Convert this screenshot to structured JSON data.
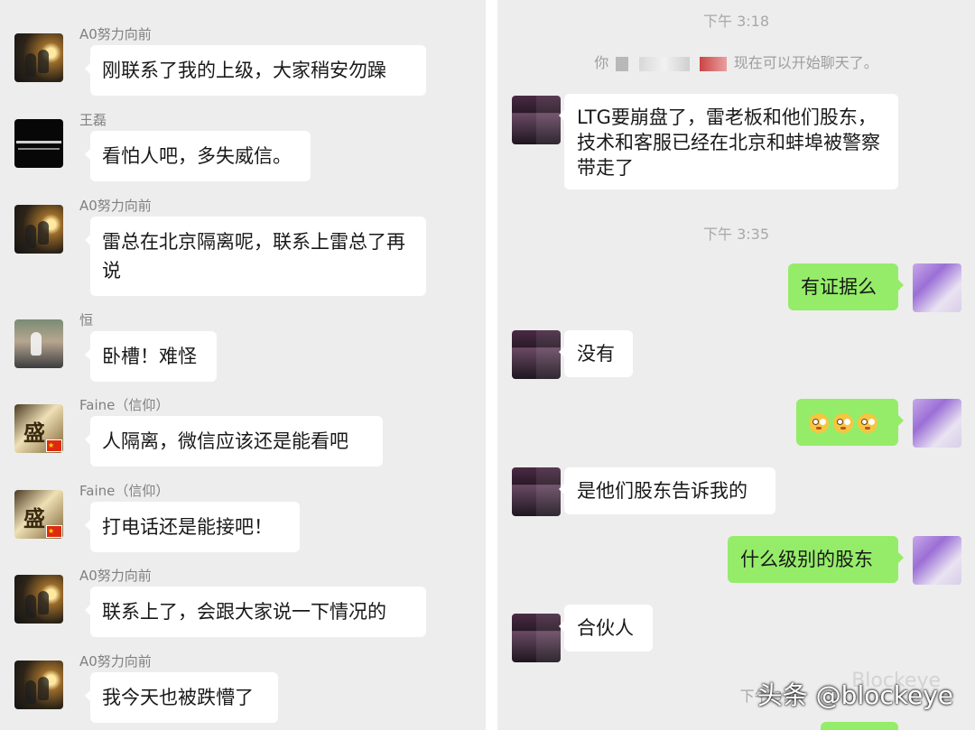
{
  "left_chat": {
    "messages": [
      {
        "sender": "A0努力向前",
        "text": "刚联系了我的上级，大家稍安勿躁"
      },
      {
        "sender": "王磊",
        "text": "看怕人吧，多失威信。"
      },
      {
        "sender": "A0努力向前",
        "text": "雷总在北京隔离呢，联系上雷总了再说"
      },
      {
        "sender": "恒",
        "text": "卧槽！难怪"
      },
      {
        "sender": "Faine（信仰）",
        "text": "人隔离，微信应该还是能看吧"
      },
      {
        "sender": "Faine（信仰）",
        "text": "打电话还是能接吧！"
      },
      {
        "sender": "A0努力向前",
        "text": "联系上了，会跟大家说一下情况的"
      },
      {
        "sender": "A0努力向前",
        "text": "我今天也被跌懵了"
      }
    ]
  },
  "right_chat": {
    "time_1": "下午 3:18",
    "system_prefix": "你",
    "system_suffix": "现在可以开始聊天了。",
    "msg_1": "LTG要崩盘了，雷老板和他们股东，技术和客服已经在北京和蚌埠被警察带走了",
    "time_2": "下午 3:35",
    "msg_2": "有证据么",
    "msg_3": "没有",
    "msg_4_emoji": [
      "flushed-face",
      "flushed-face",
      "flushed-face"
    ],
    "msg_5": "是他们股东告诉我的",
    "msg_6": "什么级别的股东",
    "msg_7": "合伙人",
    "time_3": "下午 3:4"
  },
  "watermark": {
    "text": "头条 @blockeye",
    "faint": "Blockeye"
  },
  "colors": {
    "chat_bg": "#ededed",
    "bubble_in": "#ffffff",
    "bubble_out": "#95ec69"
  }
}
